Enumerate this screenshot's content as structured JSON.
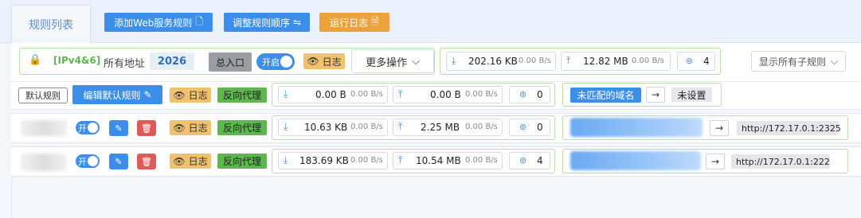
{
  "tabs": {
    "rules_list": "规则列表"
  },
  "toolbar": {
    "add_web_rule": "添加Web服务规则",
    "adjust_order": "调整规则顺序",
    "run_log": "运行日志"
  },
  "main_entry": {
    "protocol": "[IPv4&6]",
    "address": "所有地址",
    "port": "2026",
    "entry_label": "总入口",
    "toggle_label": "开启",
    "log_label": "日志",
    "more_ops": "更多操作",
    "down_total": "202.16 KB",
    "down_rate": "0.00 B/s",
    "up_total": "12.82 MB",
    "up_rate": "0.00 B/s",
    "conn_count": "4",
    "show_sub_rules": "显示所有子规则"
  },
  "default_rule": {
    "label": "默认规则",
    "edit_label": "编辑默认规则",
    "log_label": "日志",
    "proxy_label": "反向代理",
    "down_total": "0.00 B",
    "down_rate": "0.00 B/s",
    "up_total": "0.00 B",
    "up_rate": "0.00 B/s",
    "conn_count": "0",
    "unmatched_domain": "未匹配的域名",
    "arrow": "→",
    "target": "未设置"
  },
  "rules": [
    {
      "toggle_label": "开",
      "log_label": "日志",
      "proxy_label": "反向代理",
      "down_total": "10.63 KB",
      "down_rate": "0.00 B/s",
      "up_total": "2.25 MB",
      "up_rate": "0.00 B/s",
      "conn_count": "0",
      "arrow": "→",
      "target": "http://172.17.0.1:2325"
    },
    {
      "toggle_label": "开",
      "log_label": "日志",
      "proxy_label": "反向代理",
      "down_total": "183.69 KB",
      "down_rate": "0.00 B/s",
      "up_total": "10.54 MB",
      "up_rate": "0.00 B/s",
      "conn_count": "4",
      "arrow": "→",
      "target": "http://172.17.0.1:222"
    }
  ],
  "colors": {
    "primary": "#3d8ee8",
    "warning": "#eba23c",
    "success": "#5cb84c"
  }
}
